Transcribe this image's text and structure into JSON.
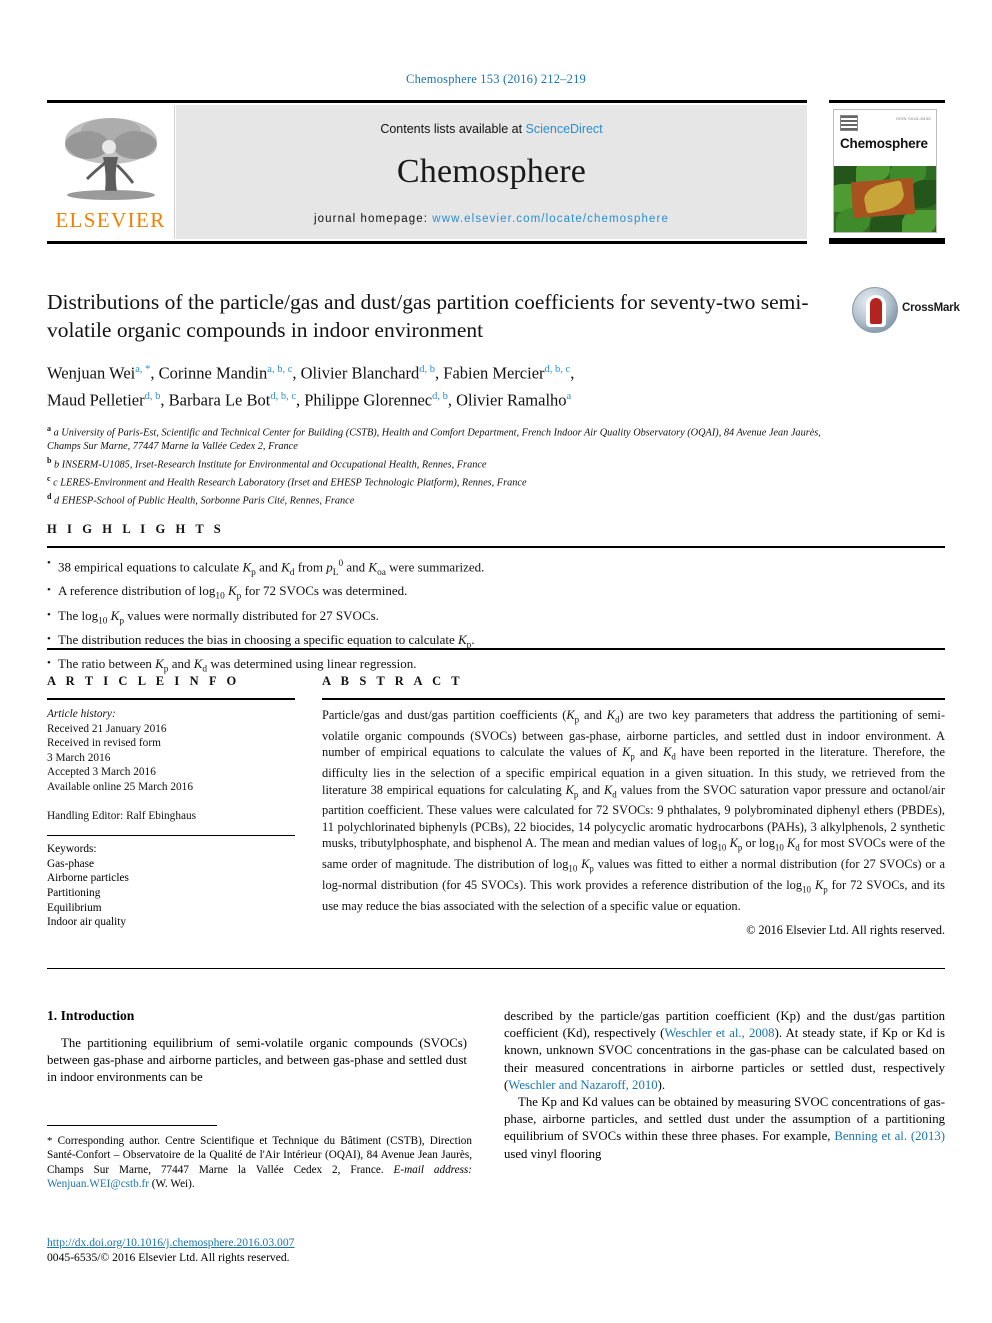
{
  "running_head": "Chemosphere 153 (2016) 212–219",
  "masthead": {
    "contents_prefix": "Contents lists available at ",
    "sciencedirect": "ScienceDirect",
    "journal_name": "Chemosphere",
    "homepage_label": "journal homepage:",
    "homepage_url": "www.elsevier.com/locate/chemosphere",
    "publisher_logo_text": "ELSEVIER",
    "cover_title": "Chemosphere",
    "cover_issn_tiny": "ISSN 0045-6535"
  },
  "article": {
    "title": "Distributions of the particle/gas and dust/gas partition coefficients for seventy-two semi-volatile organic compounds in indoor environment",
    "crossmark_label": "CrossMark",
    "authors_line1": "Wenjuan Wei a, *, Corinne Mandin a, b, c, Olivier Blanchard d, b, Fabien Mercier d, b, c,",
    "authors_line2": "Maud Pelletier d, b, Barbara Le Bot d, b, c, Philippe Glorennec d, b, Olivier Ramalho a",
    "affiliations": [
      "a University of Paris-Est, Scientific and Technical Center for Building (CSTB), Health and Comfort Department, French Indoor Air Quality Observatory (OQAI), 84 Avenue Jean Jaurès, Champs Sur Marne, 77447 Marne la Vallée Cedex 2, France",
      "b INSERM-U1085, Irset-Research Institute for Environmental and Occupational Health, Rennes, France",
      "c LERES-Environment and Health Research Laboratory (Irset and EHESP Technologic Platform), Rennes, France",
      "d EHESP-School of Public Health, Sorbonne Paris Cité, Rennes, France"
    ]
  },
  "highlights": {
    "heading": "H I G H L I G H T S",
    "items": [
      "38 empirical equations to calculate Kp and Kd from p0L and Koa were summarized.",
      "A reference distribution of log10 Kp for 72 SVOCs was determined.",
      "The log10 Kp values were normally distributed for 27 SVOCs.",
      "The distribution reduces the bias in choosing a specific equation to calculate Kp.",
      "The ratio between Kp and Kd was determined using linear regression."
    ]
  },
  "article_info": {
    "heading": "A R T I C L E  I N F O",
    "history_label": "Article history:",
    "history": [
      "Received 21 January 2016",
      "Received in revised form",
      "3 March 2016",
      "Accepted 3 March 2016",
      "Available online 25 March 2016"
    ],
    "handling_editor": "Handling Editor: Ralf Ebinghaus",
    "keywords_label": "Keywords:",
    "keywords": [
      "Gas-phase",
      "Airborne particles",
      "Partitioning",
      "Equilibrium",
      "Indoor air quality"
    ]
  },
  "abstract": {
    "heading": "A B S T R A C T",
    "text": "Particle/gas and dust/gas partition coefficients (Kp and Kd) are two key parameters that address the partitioning of semi-volatile organic compounds (SVOCs) between gas-phase, airborne particles, and settled dust in indoor environment. A number of empirical equations to calculate the values of Kp and Kd have been reported in the literature. Therefore, the difficulty lies in the selection of a specific empirical equation in a given situation. In this study, we retrieved from the literature 38 empirical equations for calculating Kp and Kd values from the SVOC saturation vapor pressure and octanol/air partition coefficient. These values were calculated for 72 SVOCs: 9 phthalates, 9 polybrominated diphenyl ethers (PBDEs), 11 polychlorinated biphenyls (PCBs), 22 biocides, 14 polycyclic aromatic hydrocarbons (PAHs), 3 alkylphenols, 2 synthetic musks, tributylphosphate, and bisphenol A. The mean and median values of log10 Kp or log10 Kd for most SVOCs were of the same order of magnitude. The distribution of log10 Kp values was fitted to either a normal distribution (for 27 SVOCs) or a log-normal distribution (for 45 SVOCs). This work provides a reference distribution of the log10 Kp for 72 SVOCs, and its use may reduce the bias associated with the selection of a specific value or equation.",
    "copyright": "© 2016 Elsevier Ltd. All rights reserved."
  },
  "body": {
    "section_number_title": "1. Introduction",
    "left_para_1": "The partitioning equilibrium of semi-volatile organic compounds (SVOCs) between gas-phase and airborne particles, and between gas-phase and settled dust in indoor environments can be",
    "right_para_1_a": "described by the particle/gas partition coefficient (Kp) and the dust/gas partition coefficient (Kd), respectively (",
    "right_ref_1": "Weschler et al., 2008",
    "right_para_1_b": "). At steady state, if Kp or Kd is known, unknown SVOC concentrations in the gas-phase can be calculated based on their measured concentrations in airborne particles or settled dust, respectively (",
    "right_ref_2": "Weschler and Nazaroff, 2010",
    "right_para_1_c": ").",
    "right_para_2_a": "The Kp and Kd values can be obtained by measuring SVOC concentrations of gas-phase, airborne particles, and settled dust under the assumption of a partitioning equilibrium of SVOCs within these three phases. For example, ",
    "right_ref_3": "Benning et al. (2013)",
    "right_para_2_b": " used vinyl flooring"
  },
  "footnote": {
    "star": "*",
    "text": " Corresponding author. Centre Scientifique et Technique du Bâtiment (CSTB), Direction Santé-Confort – Observatoire de la Qualité de l'Air Intérieur (OQAI), 84 Avenue Jean Jaurès, Champs Sur Marne, 77447 Marne la Vallée Cedex 2, France.",
    "email_label": "E-mail address:",
    "email": "Wenjuan.WEI@cstb.fr",
    "email_suffix": " (W. Wei)."
  },
  "doi": {
    "url": "http://dx.doi.org/10.1016/j.chemosphere.2016.03.007",
    "issn_line": "0045-6535/© 2016 Elsevier Ltd. All rights reserved."
  },
  "colors": {
    "link_blue": "#1a74b0",
    "sciencedirect_blue": "#2a8fd0",
    "elsevier_orange": "#f08100",
    "masthead_gray": "#e6e6e6"
  }
}
